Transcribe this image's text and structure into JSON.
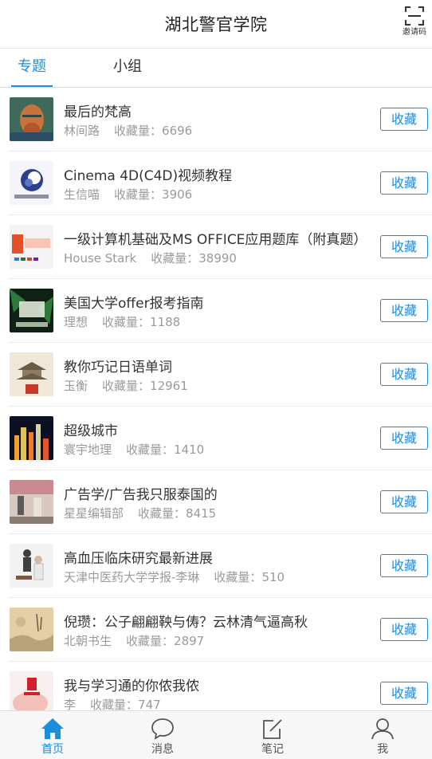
{
  "header": {
    "title": "湖北警官学院",
    "invite_label": "邀请码"
  },
  "tabs": [
    {
      "label": "专题",
      "active": true
    },
    {
      "label": "小组",
      "active": false
    }
  ],
  "button_label": "收藏",
  "count_prefix": "收藏量：",
  "items": [
    {
      "title": "最后的梵高",
      "author": "林间路",
      "count": "6696",
      "icon": "van-gogh-portrait-thumbnail"
    },
    {
      "title": "Cinema 4D(C4D)视频教程",
      "author": "生信喵",
      "count": "3906",
      "icon": "cinema4d-logo-thumbnail"
    },
    {
      "title": "一级计算机基础及MS OFFICE应用题库（附真题）",
      "author": "House Stark",
      "count": "38990",
      "icon": "office-logo-thumbnail"
    },
    {
      "title": "美国大学offer报考指南",
      "author": "理想",
      "count": "1188",
      "icon": "ivy-league-thumbnail"
    },
    {
      "title": "教你巧记日语单词",
      "author": "玉衡",
      "count": "12961",
      "icon": "japanese-pagoda-thumbnail"
    },
    {
      "title": "超级城市",
      "author": "寰宇地理",
      "count": "1410",
      "icon": "night-city-thumbnail"
    },
    {
      "title": "广告学/广告我只服泰国的",
      "author": "星星编辑部",
      "count": "8415",
      "icon": "advertising-scene-thumbnail"
    },
    {
      "title": "高血压临床研究最新进展",
      "author": "天津中医药大学学报-李琳",
      "count": "510",
      "icon": "medical-consultation-thumbnail"
    },
    {
      "title": "倪瓒：公子翩翩鞅与俦？云林清气逼高秋",
      "author": "北朝书生",
      "count": "2897",
      "icon": "ink-painting-thumbnail"
    },
    {
      "title": "我与学习通的你侬我侬",
      "author": "李",
      "count": "747",
      "icon": "xuexitong-hand-thumbnail"
    }
  ],
  "bottom_nav": [
    {
      "label": "首页",
      "icon": "home-icon",
      "active": true
    },
    {
      "label": "消息",
      "icon": "message-icon",
      "active": false
    },
    {
      "label": "笔记",
      "icon": "note-icon",
      "active": false
    },
    {
      "label": "我",
      "icon": "profile-icon",
      "active": false
    }
  ],
  "colors": {
    "accent": "#1a8ddb",
    "meta_text": "#9a9a9a",
    "title_text": "#333333"
  }
}
